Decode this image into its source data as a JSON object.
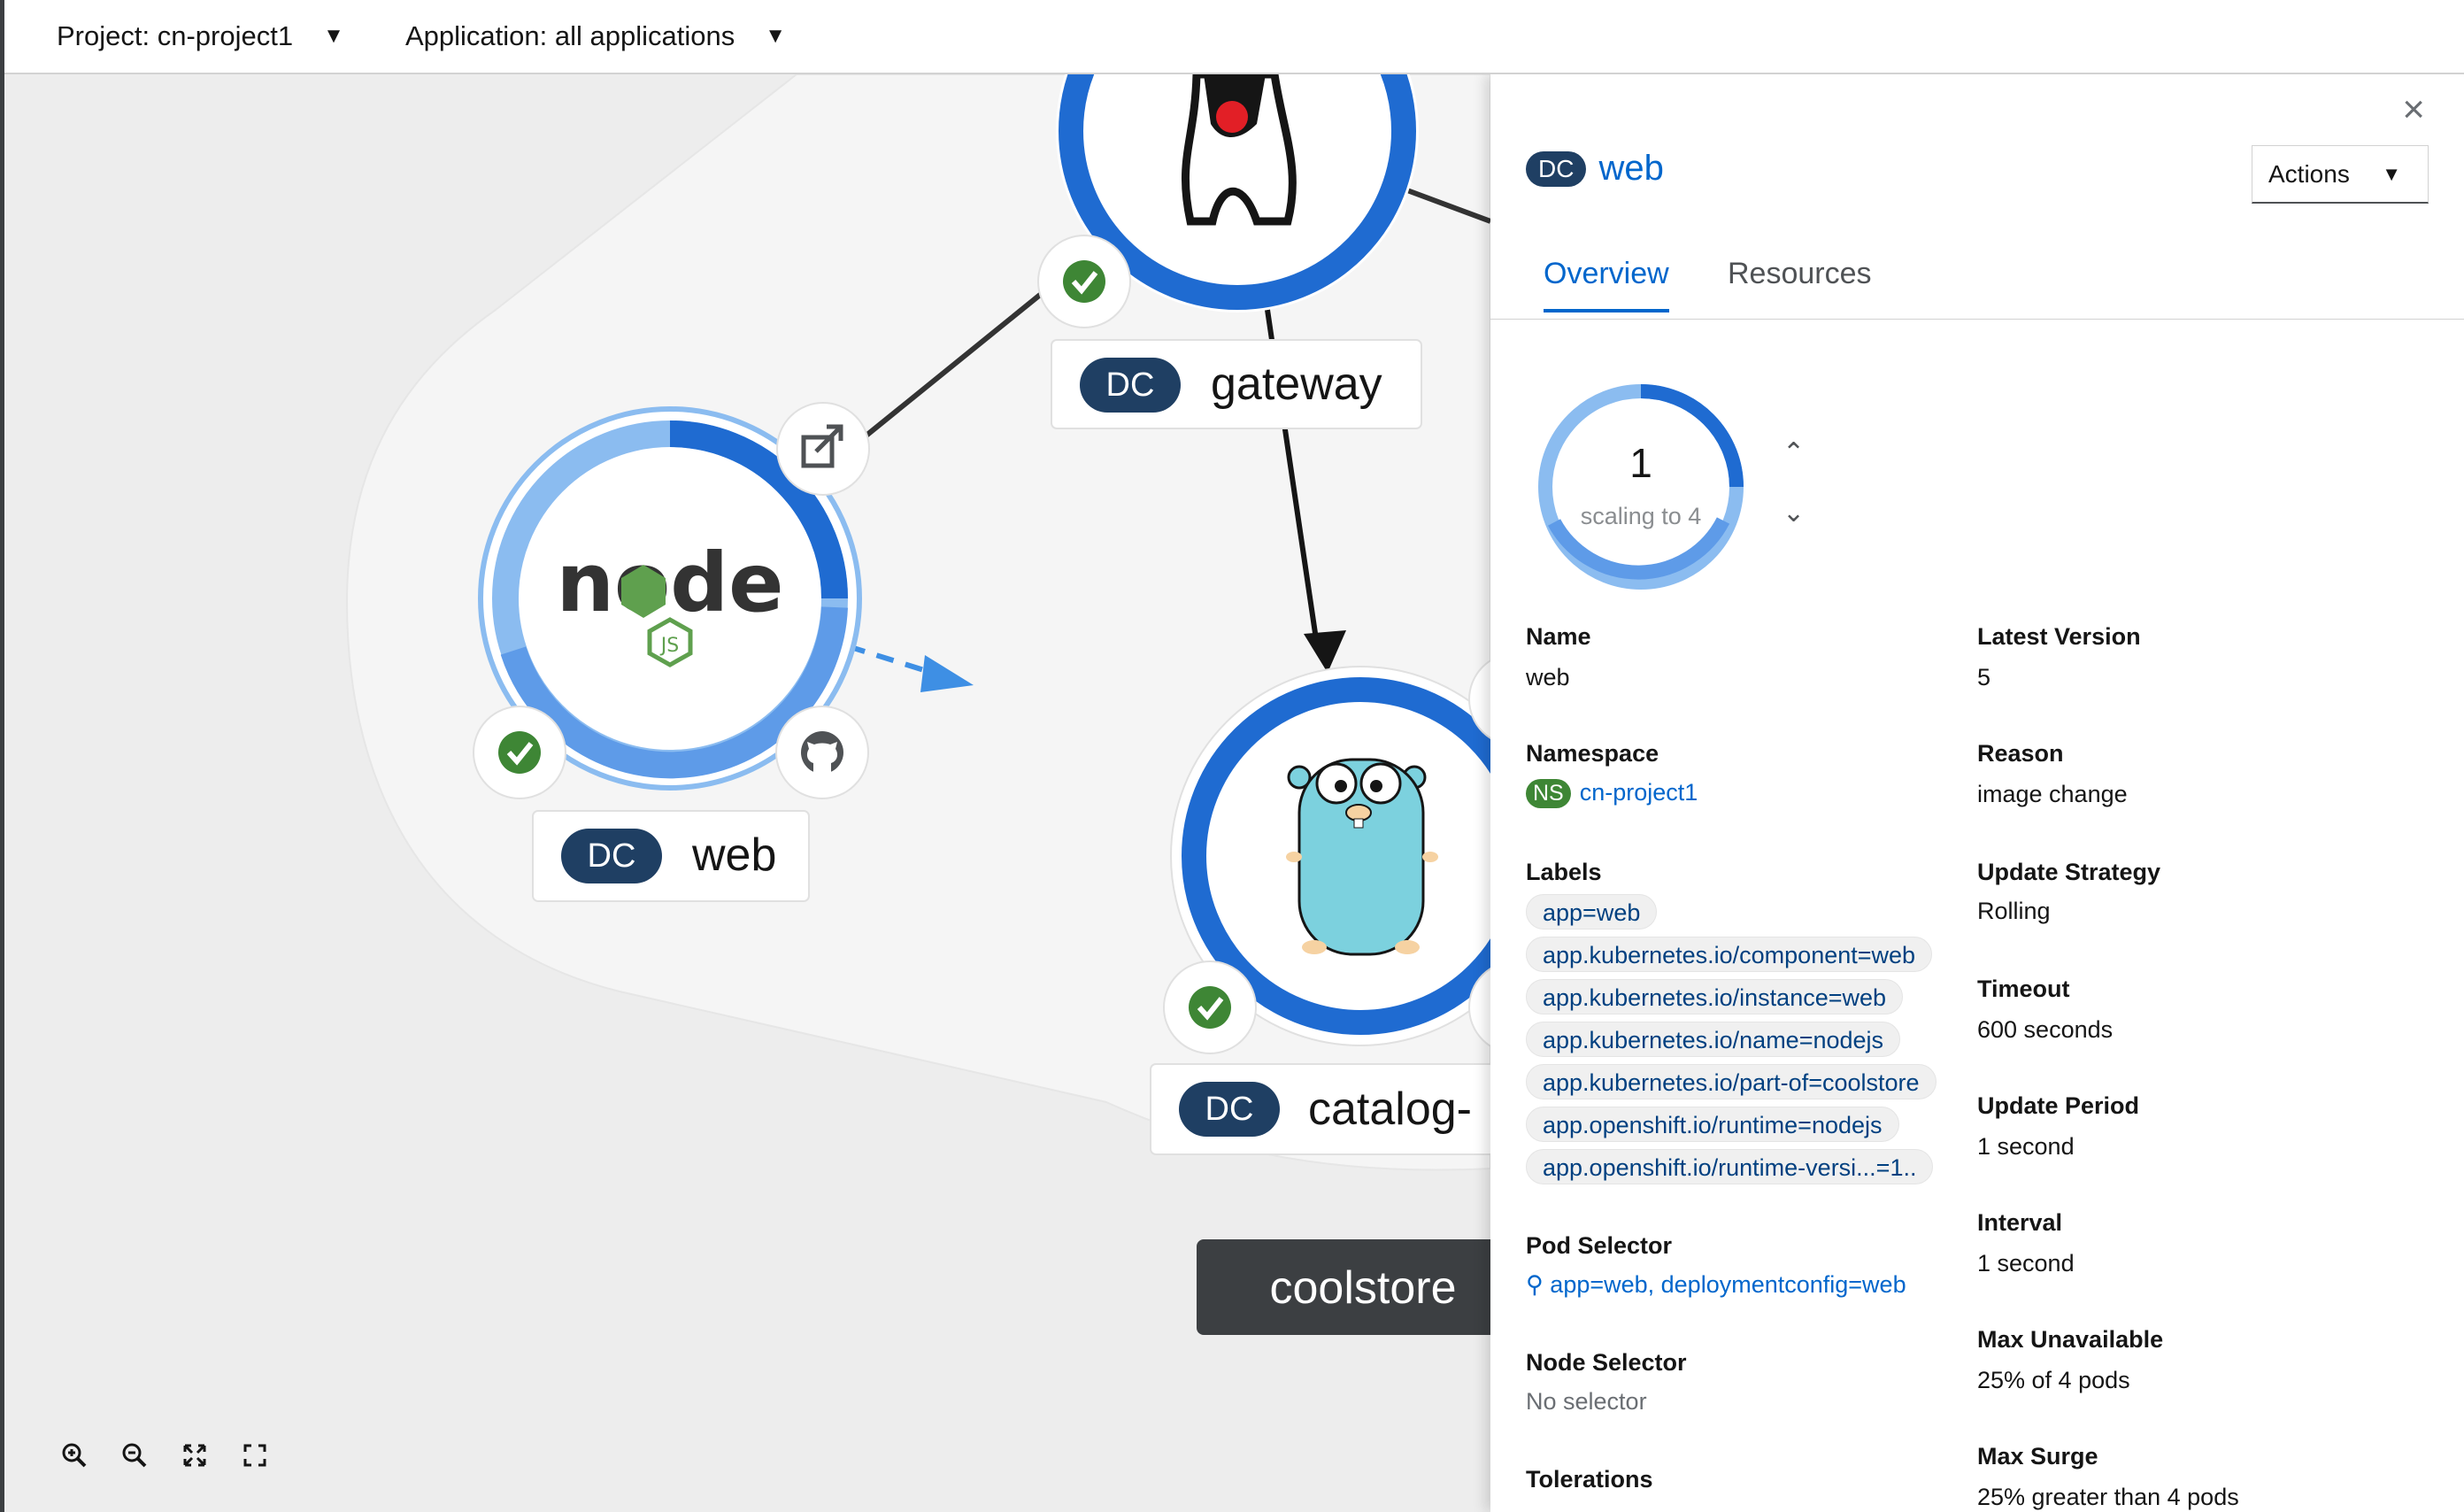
{
  "context_bar": {
    "project_label": "Project: cn-project1",
    "application_label": "Application: all applications"
  },
  "topology": {
    "nodes": [
      {
        "badge": "DC",
        "name": "gateway"
      },
      {
        "badge": "DC",
        "name": "web"
      },
      {
        "badge": "DC",
        "name": "catalog-"
      }
    ],
    "group_label": "coolstore",
    "icons": {
      "nodejs_logo": "node",
      "nodejs_js": "JS"
    }
  },
  "side_panel": {
    "badge": "DC",
    "title": "web",
    "actions_label": "Actions",
    "tabs": [
      "Overview",
      "Resources"
    ],
    "donut": {
      "count": "1",
      "subtitle": "scaling to 4",
      "current_pods": 1,
      "desired_pods": 4
    },
    "details_left": {
      "name_title": "Name",
      "name_value": "web",
      "namespace_title": "Namespace",
      "namespace_badge": "NS",
      "namespace_value": "cn-project1",
      "labels_title": "Labels",
      "labels": [
        "app=web",
        "app.kubernetes.io/component=web",
        "app.kubernetes.io/instance=web",
        "app.kubernetes.io/name=nodejs",
        "app.kubernetes.io/part-of=coolstore",
        "app.openshift.io/runtime=nodejs",
        "app.openshift.io/runtime-versi...=1.."
      ],
      "pod_selector_title": "Pod Selector",
      "pod_selector_value": "app=web, deploymentconfig=web",
      "node_selector_title": "Node Selector",
      "node_selector_value": "No selector",
      "tolerations_title": "Tolerations"
    },
    "details_right": {
      "latest_version_title": "Latest Version",
      "latest_version_value": "5",
      "reason_title": "Reason",
      "reason_value": "image change",
      "update_strategy_title": "Update Strategy",
      "update_strategy_value": "Rolling",
      "timeout_title": "Timeout",
      "timeout_value": "600 seconds",
      "update_period_title": "Update Period",
      "update_period_value": "1 second",
      "interval_title": "Interval",
      "interval_value": "1 second",
      "max_unavailable_title": "Max Unavailable",
      "max_unavailable_value": "25% of 4 pods",
      "max_surge_title": "Max Surge",
      "max_surge_value": "25% greater than 4 pods"
    }
  },
  "colors": {
    "accent": "#0066cc",
    "ring_dark": "#2b6fd0",
    "ring_light": "#8bbcf0",
    "success": "#3e8635",
    "badge": "#1f3f63"
  }
}
